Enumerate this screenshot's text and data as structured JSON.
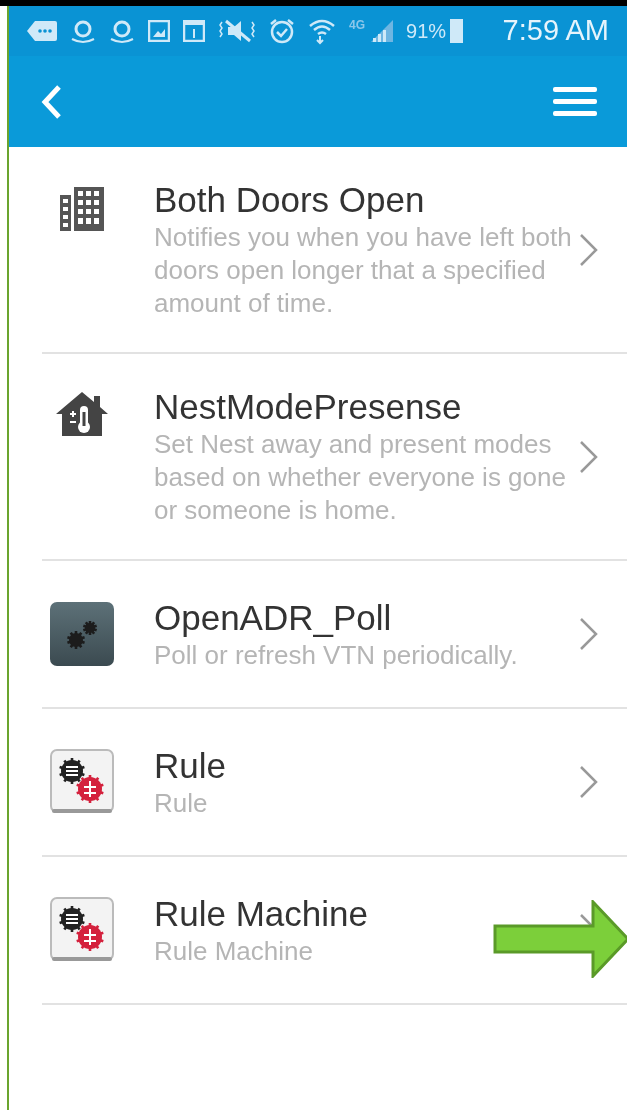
{
  "status_bar": {
    "network": "4G",
    "battery": "91%",
    "time": "7:59 AM"
  },
  "items": [
    {
      "kind": "building",
      "title": "Both Doors Open",
      "description": "Notifies you when you have left both doors open longer that a specified amount of time.",
      "highlighted": false
    },
    {
      "kind": "house",
      "title": "NestModePresense",
      "description": "Set Nest away and present modes based on whether everyone is gone or someone is home.",
      "highlighted": false
    },
    {
      "kind": "gears",
      "title": "OpenADR_Poll",
      "description": "Poll or refresh VTN periodically.",
      "highlighted": false
    },
    {
      "kind": "rule",
      "title": "Rule",
      "description": "Rule",
      "highlighted": false
    },
    {
      "kind": "rule",
      "title": "Rule Machine",
      "description": "Rule Machine",
      "highlighted": true
    }
  ]
}
